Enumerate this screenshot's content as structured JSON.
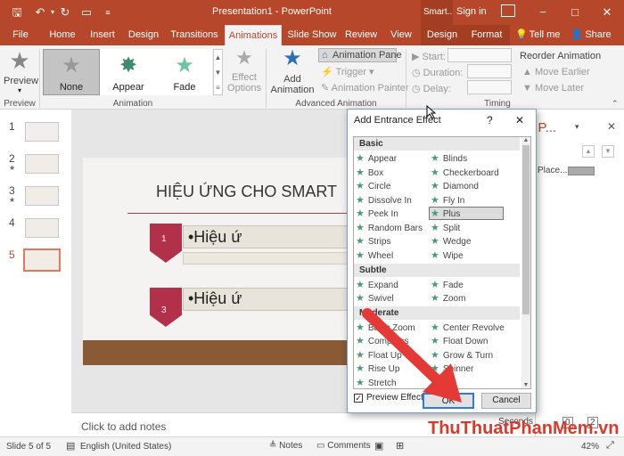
{
  "titlebar": {
    "doc_title": "Presentation1 - PowerPoint",
    "context_tab_title": "Smart...",
    "signin": "Sign in",
    "minimize": "−",
    "maximize": "□",
    "close": "✕",
    "bg_color": "#b7472a"
  },
  "tabs": [
    "File",
    "Home",
    "Insert",
    "Design",
    "Transitions",
    "Animations",
    "Slide Show",
    "Review",
    "View",
    "Design",
    "Format"
  ],
  "tellme": "Tell me",
  "share": "Share",
  "ribbon": {
    "preview": "Preview",
    "preview_group": "Preview",
    "gallery": [
      "None",
      "Appear",
      "Fade"
    ],
    "animation_group": "Animation",
    "effect_options_1": "Effect",
    "effect_options_2": "Options",
    "add_animation_1": "Add",
    "add_animation_2": "Animation",
    "animation_pane": "Animation Pane",
    "trigger": "Trigger",
    "animation_painter": "Animation Painter",
    "advanced_group": "Advanced Animation",
    "start": "Start:",
    "duration": "Duration:",
    "delay": "Delay:",
    "reorder": "Reorder Animation",
    "move_earlier": "Move Earlier",
    "move_later": "Move Later",
    "timing_group": "Timing"
  },
  "slides": [
    {
      "num": "1",
      "star": ""
    },
    {
      "num": "2",
      "star": "★"
    },
    {
      "num": "3",
      "star": "★"
    },
    {
      "num": "4",
      "star": ""
    },
    {
      "num": "5",
      "star": ""
    }
  ],
  "slide": {
    "title": "HIỆU ỨNG CHO SMART",
    "item1_num": "1",
    "item1_text": "•Hiệu ứ",
    "item3_num": "3",
    "item3_text": "•Hiệu ứ"
  },
  "notes_placeholder": "Click to add notes",
  "animpane": {
    "title": "n P...",
    "item": "Place...",
    "seconds": "Seconds",
    "scale0": "0",
    "scale2": "2"
  },
  "dialog": {
    "title": "Add Entrance Effect",
    "help": "?",
    "close": "✕",
    "categories": [
      {
        "name": "Basic",
        "effects": [
          "Appear",
          "Blinds",
          "Box",
          "Checkerboard",
          "Circle",
          "Diamond",
          "Dissolve In",
          "Fly In",
          "Peek In",
          "Plus",
          "Random Bars",
          "Split",
          "Strips",
          "Wedge",
          "Wheel",
          "Wipe"
        ]
      },
      {
        "name": "Subtle",
        "effects": [
          "Expand",
          "Fade",
          "Swivel",
          "Zoom"
        ]
      },
      {
        "name": "Moderate",
        "effects": [
          "Basic Zoom",
          "Center Revolve",
          "Compress",
          "Float Down",
          "Float Up",
          "Grow & Turn",
          "Rise Up",
          "Spinner",
          "Stretch",
          ""
        ]
      }
    ],
    "selected": "Plus",
    "preview_effect": "Preview Effect",
    "ok": "OK",
    "cancel": "Cancel"
  },
  "status": {
    "slide_info": "Slide 5 of 5",
    "language": "English (United States)",
    "notes": "Notes",
    "comments": "Comments",
    "zoom": "42%"
  },
  "watermark": "ThuThuatPhanMem.vn",
  "colors": {
    "accent": "#b7472a",
    "star_green": "#4a9a78",
    "arrow_red": "#e53935",
    "ok_border": "#2f7bd7"
  }
}
